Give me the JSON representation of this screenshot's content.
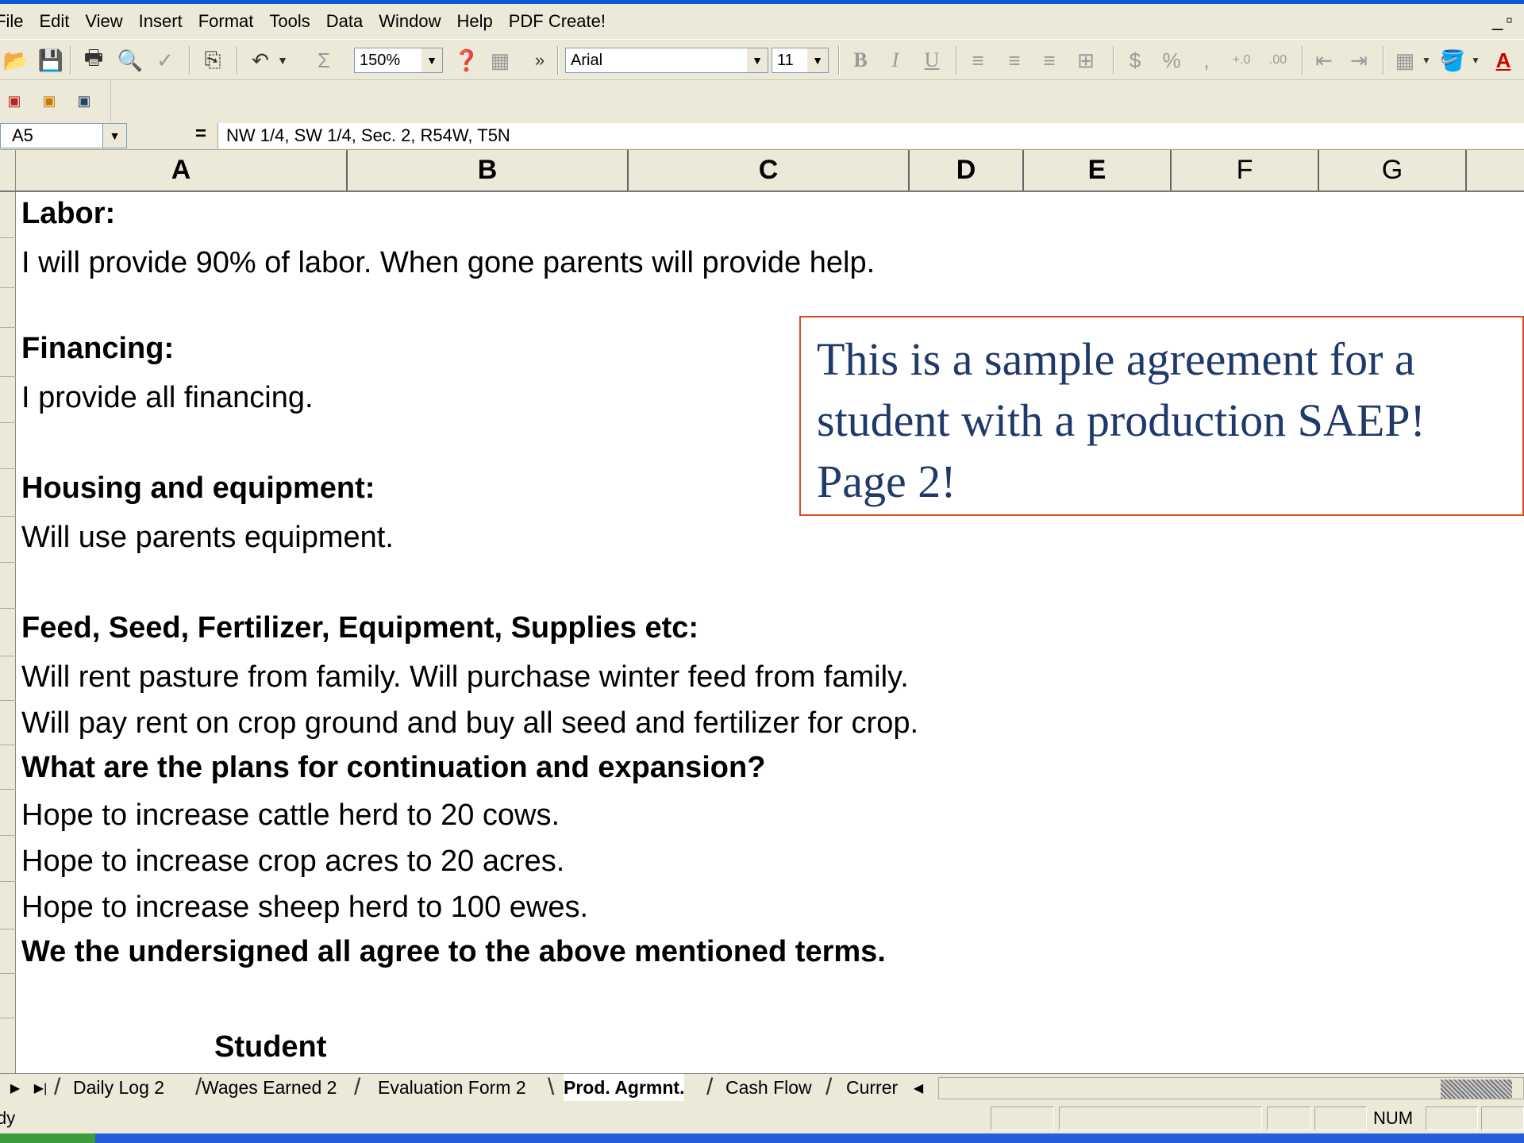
{
  "menu": [
    "File",
    "Edit",
    "View",
    "Insert",
    "Format",
    "Tools",
    "Data",
    "Window",
    "Help",
    "PDF Create!"
  ],
  "toolbar": {
    "zoom": "150%",
    "font_name": "Arial",
    "font_size": "11",
    "bold": "B",
    "italic": "I",
    "underline": "U",
    "sum": "Σ",
    "currency": "$",
    "percent": "%",
    "comma": ",",
    "more": "»"
  },
  "formula_bar": {
    "name_box": "A5",
    "equals": "=",
    "content": "NW 1/4, SW 1/4, Sec. 2, R54W, T5N"
  },
  "columns": [
    "A",
    "B",
    "C",
    "D",
    "E",
    "F",
    "G"
  ],
  "sheet_lines": [
    "Labor:",
    "I will provide 90% of  labor.  When gone parents will provide help.",
    "Financing:",
    "I provide all financing.",
    "Housing and equipment:",
    "Will use parents equipment.",
    "Feed, Seed, Fertilizer, Equipment, Supplies etc:",
    "Will rent pasture from family.  Will purchase winter feed from family.",
    "Will pay rent on crop ground and buy all seed and fertilizer for crop.",
    "What are the plans for continuation and expansion?",
    "Hope to increase cattle herd to 20 cows.",
    "Hope to increase crop acres to 20 acres.",
    "Hope to increase sheep herd to 100 ewes.",
    "We the undersigned all agree to the above mentioned terms.",
    "Student"
  ],
  "note": {
    "line1": "This is a sample agreement for a",
    "line2": "student with a production SAEP!",
    "line3": "Page 2!"
  },
  "tabs": [
    "Daily Log 2",
    "Wages Earned 2",
    "Evaluation Form 2",
    "Prod. Agrmnt.",
    "Cash Flow",
    "Currer"
  ],
  "active_tab": "Prod. Agrmnt.",
  "status": {
    "text": "dy",
    "num": "NUM"
  },
  "colors": {
    "note_text": "#1f3a6a",
    "note_border": "#e04a20",
    "taskbar": "#245edb",
    "chrome": "#ece9d8"
  }
}
